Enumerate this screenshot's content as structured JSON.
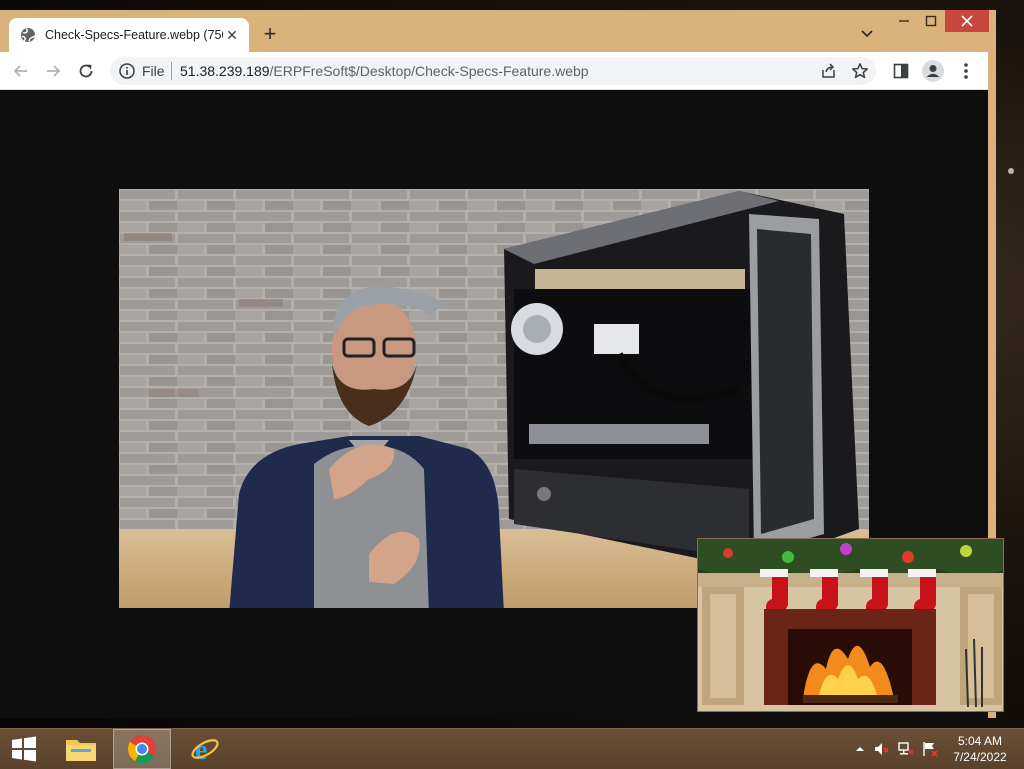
{
  "browser": {
    "tab": {
      "title": "Check-Specs-Feature.webp (750"
    },
    "address": {
      "scheme_label": "File",
      "host": "51.38.239.189",
      "path": "/ERPFreSoft$/Desktop/Check-Specs-Feature.webp"
    }
  },
  "taskbar": {
    "apps": [
      "File Explorer",
      "Google Chrome",
      "Internet Explorer"
    ],
    "clock": {
      "time": "5:04 AM",
      "date": "7/24/2022"
    }
  },
  "colors": {
    "window_frame": "#d9b27c",
    "close_button": "#c9473d",
    "content_bg": "#0e0e0e",
    "taskbar": "#5a412b"
  },
  "icons": {
    "tab": "globe-icon",
    "toolbar": [
      "back-arrow-icon",
      "forward-arrow-icon",
      "reload-icon",
      "info-icon",
      "share-icon",
      "star-icon",
      "side-panel-icon",
      "profile-icon",
      "menu-dots-icon"
    ],
    "tray": [
      "show-hidden-icons-chevron",
      "volume-muted-icon",
      "network-icon",
      "action-center-flag-icon"
    ]
  }
}
